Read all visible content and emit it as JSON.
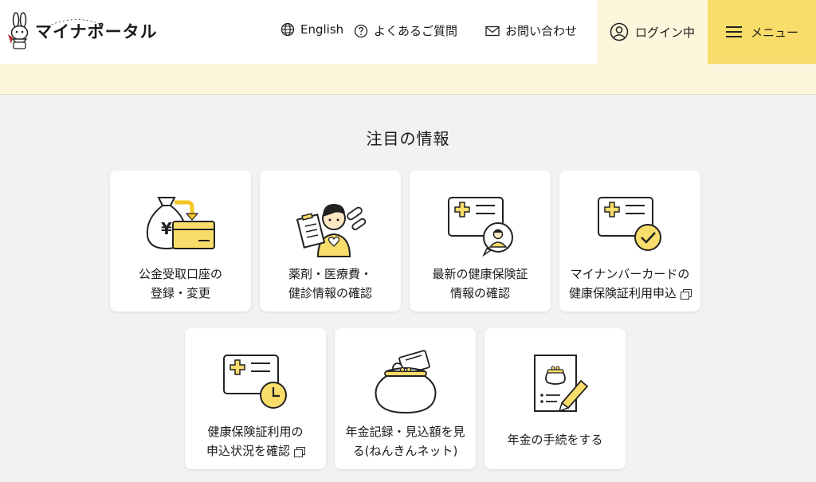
{
  "header": {
    "logo_text": "マイナポータル",
    "nav": {
      "english": "English",
      "faq": "よくあるご質問",
      "contact": "お問い合わせ"
    },
    "login": "ログイン中",
    "menu": "メニュー"
  },
  "section": {
    "title": "注目の情報"
  },
  "cards": [
    {
      "line1": "公金受取口座の",
      "line2": "登録・変更",
      "icon": "money-bag-card-icon"
    },
    {
      "line1": "薬剤・医療費・",
      "line2": "健診情報の確認",
      "icon": "person-clipboard-pills-icon"
    },
    {
      "line1": "最新の健康保険証",
      "line2": "情報の確認",
      "icon": "insurance-card-person-icon"
    },
    {
      "line1": "マイナンバーカードの",
      "line2": "健康保険証利用申込",
      "icon": "insurance-card-check-icon",
      "external": true
    },
    {
      "line1": "健康保険証利用の",
      "line2": "申込状況を確認",
      "icon": "insurance-card-clock-icon",
      "external": true
    },
    {
      "line1": "年金記録・見込額を見",
      "line2": "る(ねんきんネット)",
      "icon": "coin-purse-icon"
    },
    {
      "line1": "年金の手続をする",
      "icon": "pension-document-pen-icon"
    }
  ],
  "colors": {
    "accent_yellow": "#f9dd6a",
    "pale_yellow": "#fdf6dc",
    "background": "#f2f2f2"
  }
}
